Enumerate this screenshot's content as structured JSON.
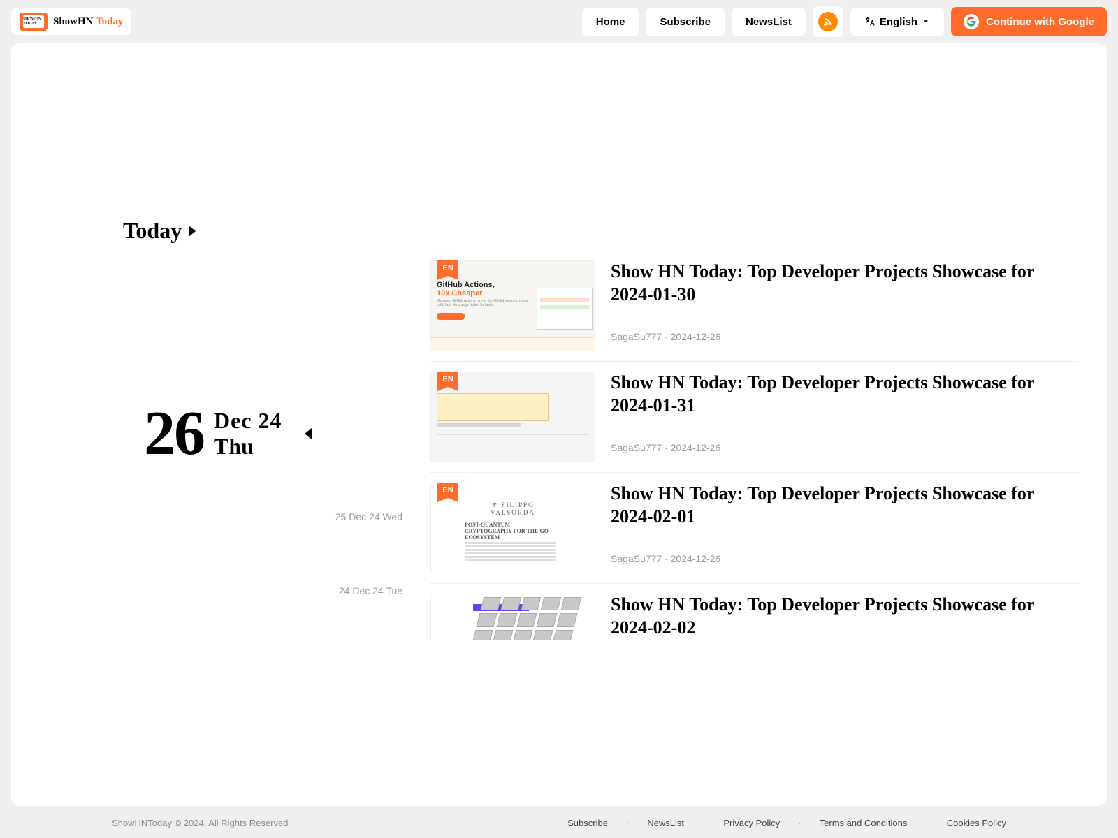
{
  "brand": {
    "name_main": "ShowHN ",
    "name_accent": "Today",
    "badge_text": "SHOWHN TODAY"
  },
  "nav": {
    "home": "Home",
    "subscribe": "Subscribe",
    "newslist": "NewsList",
    "lang_label": "English",
    "google_btn": "Continue with Google"
  },
  "today": {
    "heading": "Today",
    "day": "26",
    "month_year": "Dec 24",
    "dow": "Thu",
    "prev": [
      "25 Dec 24 Wed",
      "24 Dec 24 Tue"
    ]
  },
  "ribbon_label": "EN",
  "articles": [
    {
      "title": "Show HN Today: Top Developer Projects Showcase for 2024-01-30",
      "byline": "SagaSu777 · 2024-12-26"
    },
    {
      "title": "Show HN Today: Top Developer Projects Showcase for 2024-01-31",
      "byline": "SagaSu777 · 2024-12-26"
    },
    {
      "title": "Show HN Today: Top Developer Projects Showcase for 2024-02-01",
      "byline": "SagaSu777 · 2024-12-26"
    },
    {
      "title": "Show HN Today: Top Developer Projects Showcase for 2024-02-02",
      "byline": ""
    }
  ],
  "footer": {
    "copyright": "ShowHNToday © 2024, All Rights Reserved",
    "links": [
      "Subscribe",
      "NewsList",
      "Privacy Policy",
      "Terms and Conditions",
      "Cookies Policy"
    ]
  }
}
